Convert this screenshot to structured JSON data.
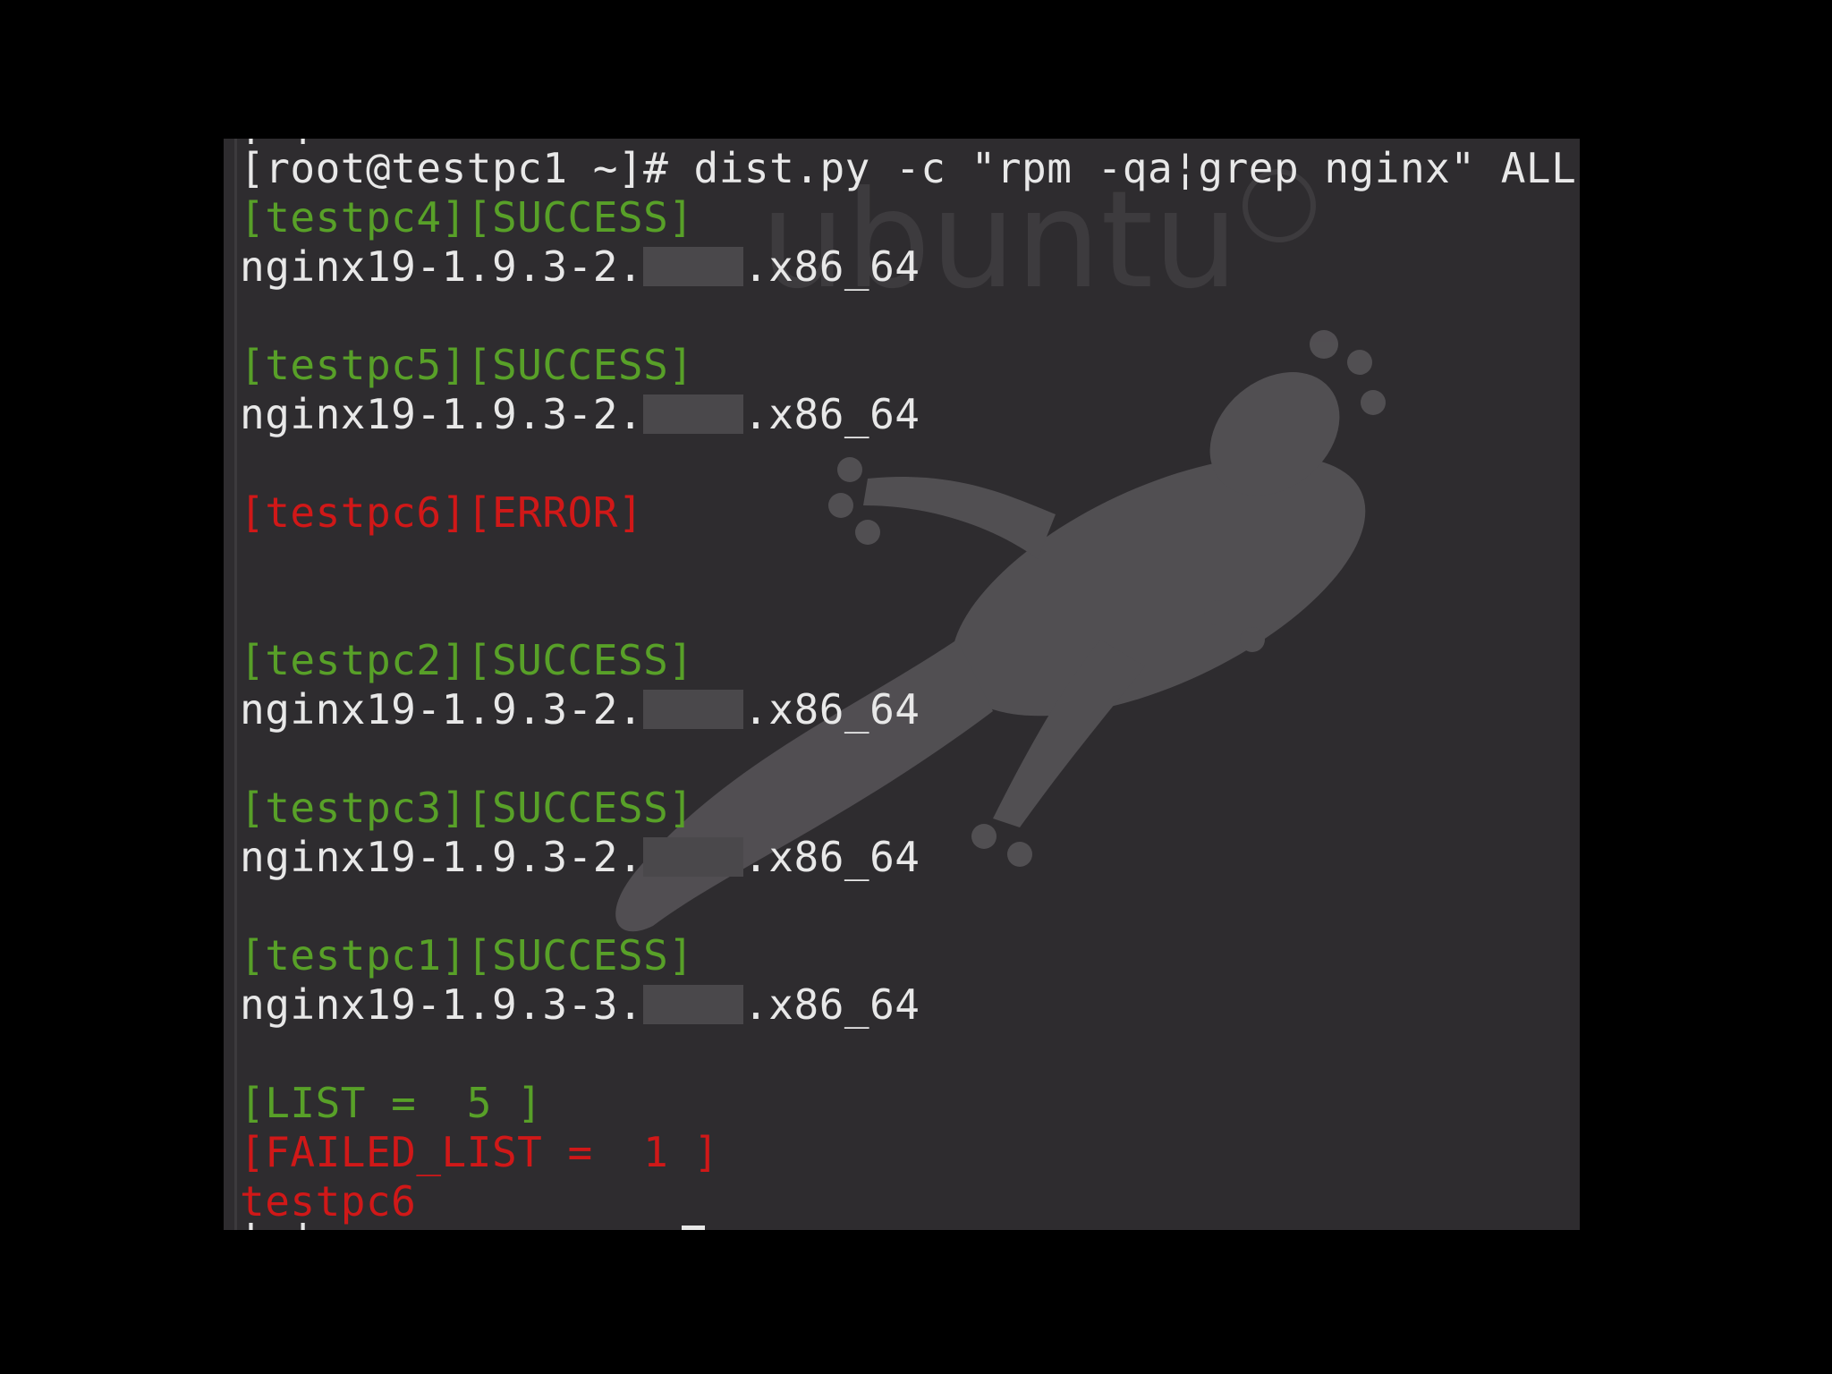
{
  "wallpaper": {
    "brand_text": "ubuntu",
    "brand_color": "#4a484b",
    "mascot": "gecko-icon"
  },
  "colors": {
    "background": "#2e2c2f",
    "text": "#e8e8e8",
    "success": "#58a028",
    "error": "#d01818"
  },
  "terminal": {
    "top_partial_line": "[ ]",
    "command_line": "[root@testpc1 ~]# dist.py -c \"rpm -qa¦grep nginx\" ALL",
    "blocks": [
      {
        "header": "[testpc4][SUCCESS]",
        "status": "success",
        "pkg_prefix": "nginx19-1.9.3-2.",
        "pkg_suffix": ".x86_64"
      },
      {
        "header": "[testpc5][SUCCESS]",
        "status": "success",
        "pkg_prefix": "nginx19-1.9.3-2.",
        "pkg_suffix": ".x86_64"
      },
      {
        "header": "[testpc6][ERROR]",
        "status": "error"
      },
      {
        "header": "[testpc2][SUCCESS]",
        "status": "success",
        "pkg_prefix": "nginx19-1.9.3-2.",
        "pkg_suffix": ".x86_64"
      },
      {
        "header": "[testpc3][SUCCESS]",
        "status": "success",
        "pkg_prefix": "nginx19-1.9.3-2.",
        "pkg_suffix": ".x86_64"
      },
      {
        "header": "[testpc1][SUCCESS]",
        "status": "success",
        "pkg_prefix": "nginx19-1.9.3-3.",
        "pkg_suffix": ".x86_64"
      }
    ],
    "summary": {
      "list": "[LIST =  5 ]",
      "failed_list": "[FAILED_LIST =  1 ]",
      "failed_host": "testpc6"
    },
    "bottom_partial_line": "[ ]"
  }
}
